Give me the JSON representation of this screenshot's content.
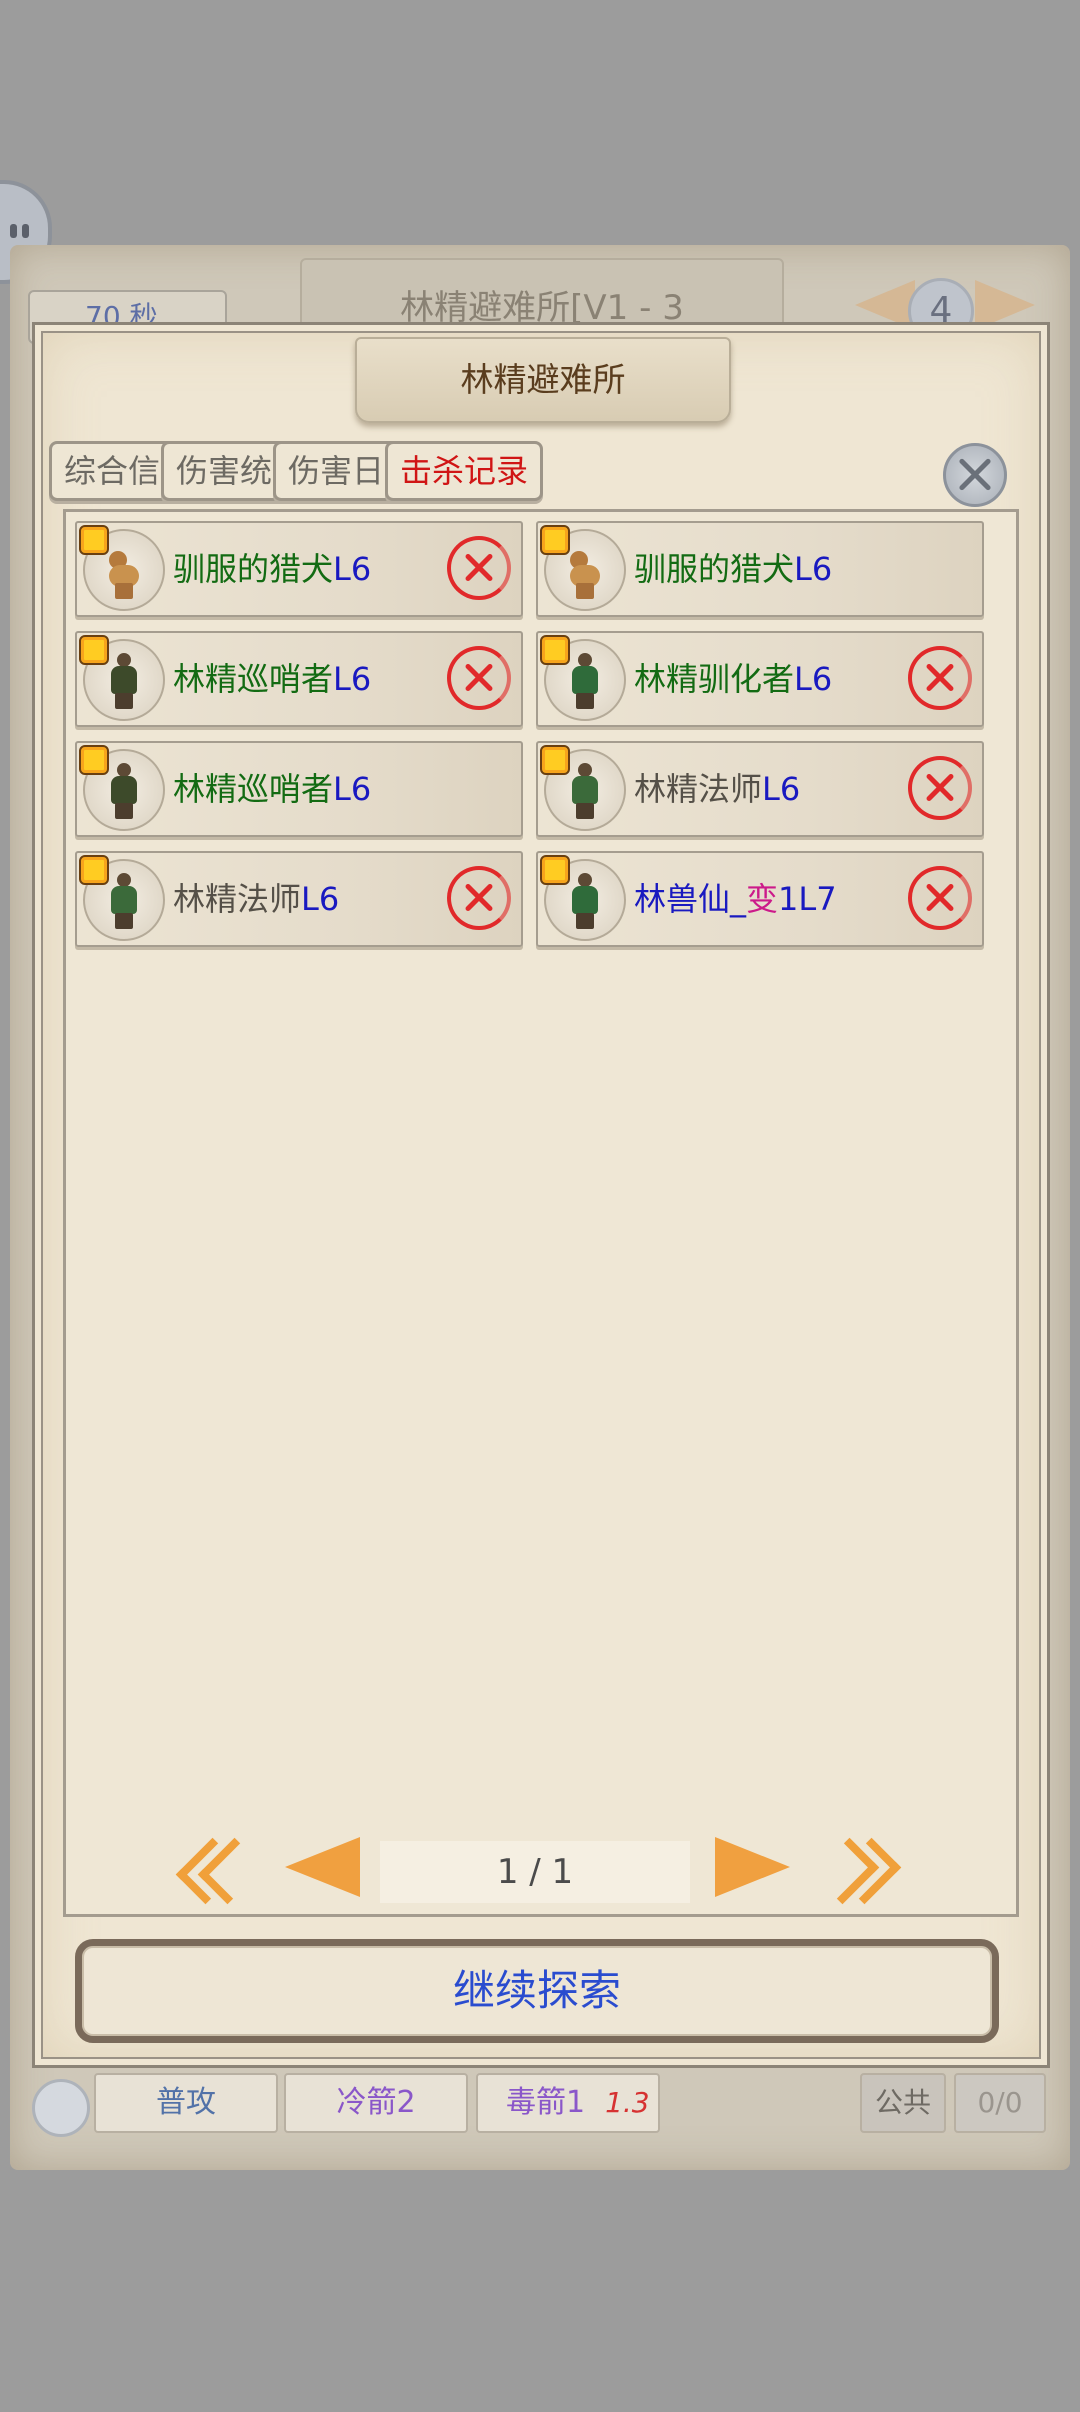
{
  "background": {
    "timer": "70 秒",
    "location_title": "林精避难所[V1 - 3",
    "level_badge": "4"
  },
  "dialog": {
    "title": "林精避难所",
    "tabs": [
      {
        "label": "综合信息",
        "active": false
      },
      {
        "label": "伤害统计",
        "active": false
      },
      {
        "label": "伤害日志",
        "active": false
      },
      {
        "label": "击杀记录",
        "active": true
      }
    ],
    "kills": [
      {
        "name": "驯服的猎犬",
        "name_color": "green",
        "level": "L6",
        "status": "failed",
        "icon": "hound-avatar"
      },
      {
        "name": "驯服的猎犬",
        "name_color": "green",
        "level": "L6",
        "status": "none",
        "icon": "hound-avatar"
      },
      {
        "name": "林精巡哨者",
        "name_color": "green",
        "level": "L6",
        "status": "failed",
        "icon": "ranger-avatar"
      },
      {
        "name": "林精驯化者",
        "name_color": "green",
        "level": "L6",
        "status": "failed",
        "icon": "tamer-avatar"
      },
      {
        "name": "林精巡哨者",
        "name_color": "green",
        "level": "L6",
        "status": "none",
        "icon": "ranger-avatar"
      },
      {
        "name": "林精法师",
        "name_color": "gray",
        "level": "L6",
        "status": "failed",
        "icon": "mage-avatar"
      },
      {
        "name": "林精法师",
        "name_color": "gray",
        "level": "L6",
        "status": "failed",
        "icon": "mage-avatar"
      },
      {
        "name": "林兽仙_",
        "name_color": "blue",
        "suffix": "变",
        "level": "1L7",
        "status": "failed",
        "icon": "tamer-avatar"
      }
    ],
    "pager": {
      "label": "1 / 1"
    },
    "continue_label": "继续探索"
  },
  "skillbar": {
    "skill_1": "普攻",
    "skill_2": "冷箭2",
    "skill_3": "毒箭1",
    "skill_3_cooldown": "1.3",
    "public_label": "公共",
    "count": "0/0"
  },
  "colors": {
    "active_tab": "#d01515",
    "name_green": "#136b13",
    "level_blue": "#1919c0",
    "status_red": "#e1292a",
    "pager_orange": "#f0a040",
    "continue_text": "#2a4ccf"
  }
}
